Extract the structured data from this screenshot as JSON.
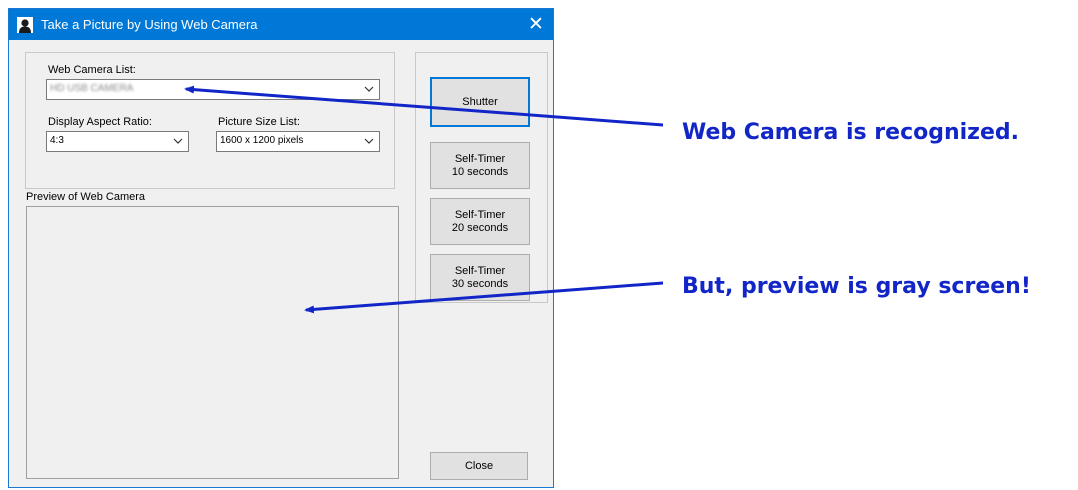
{
  "window": {
    "title": "Take a Picture by Using Web Camera",
    "close_glyph": "✕"
  },
  "settings": {
    "camera_list_label": "Web Camera List:",
    "camera_list_value": "HD USB CAMERA",
    "aspect_label": "Display Aspect Ratio:",
    "aspect_value": "4:3",
    "size_label": "Picture Size List:",
    "size_value": "1600 x 1200 pixels"
  },
  "buttons": {
    "shutter": "Shutter",
    "timer10_line1": "Self-Timer",
    "timer10_line2": "10 seconds",
    "timer20_line1": "Self-Timer",
    "timer20_line2": "20 seconds",
    "timer30_line1": "Self-Timer",
    "timer30_line2": "30 seconds",
    "close": "Close"
  },
  "preview": {
    "label": "Preview of Web Camera"
  },
  "annotations": {
    "camera_recognized": "Web Camera is recognized.",
    "preview_gray": "But, preview is gray screen!",
    "color": "#1226c8"
  },
  "theme": {
    "titlebar": "#0078d7",
    "window_bg": "#f0f0f0"
  },
  "icons": {
    "app": "person-silhouette-icon",
    "dropdown": "chevron-down-icon",
    "close": "close-icon"
  }
}
